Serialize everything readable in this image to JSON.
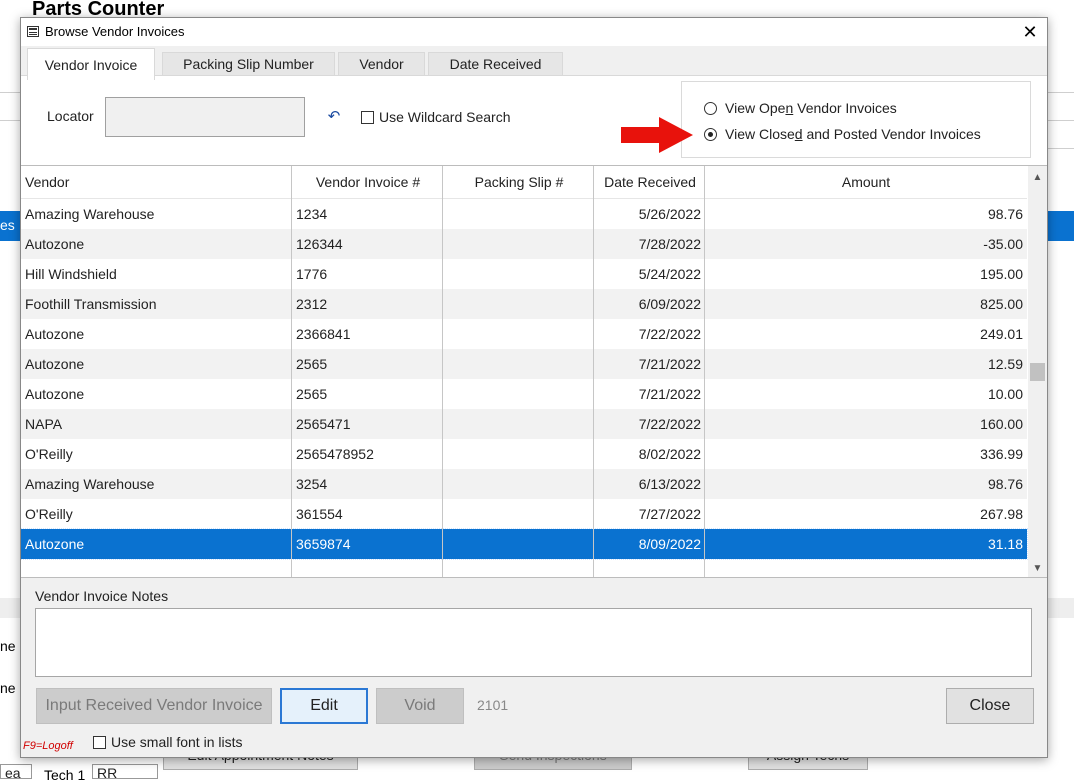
{
  "background": {
    "title": "Parts Counter",
    "blue_row_text": "es",
    "side_labels": [
      "ne",
      "ne"
    ],
    "bottom_buttons": [
      "Edit Appointment Notes",
      "Send Inspections",
      "Assign Techs"
    ],
    "bottom_fields": {
      "left": "ea",
      "tech_label": "Tech 1",
      "tech_value": "RR"
    }
  },
  "dialog": {
    "title": "Browse Vendor Invoices",
    "close_glyph": "✕",
    "tabs": [
      {
        "label": "Vendor Invoice",
        "active": true
      },
      {
        "label": "Packing Slip Number",
        "active": false
      },
      {
        "label": "Vendor",
        "active": false
      },
      {
        "label": "Date Received",
        "active": false
      }
    ],
    "locator": {
      "label": "Locator",
      "value": "",
      "reset_icon": "undo-icon"
    },
    "wildcard": {
      "label": "Use Wildcard Search",
      "checked": false
    },
    "view_options": {
      "open": {
        "prefix": "View Ope",
        "mnemonic": "n",
        "suffix": " Vendor Invoices",
        "selected": false
      },
      "closed": {
        "prefix": "View Close",
        "mnemonic": "d",
        "suffix": " and Posted Vendor Invoices",
        "selected": true
      }
    },
    "annotation_color": "#e8120c",
    "grid": {
      "columns": [
        "Vendor",
        "Vendor Invoice #",
        "Packing Slip #",
        "Date Received",
        "Amount"
      ],
      "rows": [
        {
          "vendor": "Amazing Warehouse",
          "invoice": "1234",
          "slip": "",
          "date": "5/26/2022",
          "amount": "98.76"
        },
        {
          "vendor": "Autozone",
          "invoice": "126344",
          "slip": "",
          "date": "7/28/2022",
          "amount": "-35.00"
        },
        {
          "vendor": "Hill Windshield",
          "invoice": "1776",
          "slip": "",
          "date": "5/24/2022",
          "amount": "195.00"
        },
        {
          "vendor": "Foothill Transmission",
          "invoice": "2312",
          "slip": "",
          "date": "6/09/2022",
          "amount": "825.00"
        },
        {
          "vendor": "Autozone",
          "invoice": "2366841",
          "slip": "",
          "date": "7/22/2022",
          "amount": "249.01"
        },
        {
          "vendor": "Autozone",
          "invoice": "2565",
          "slip": "",
          "date": "7/21/2022",
          "amount": "12.59"
        },
        {
          "vendor": "Autozone",
          "invoice": "2565",
          "slip": "",
          "date": "7/21/2022",
          "amount": "10.00"
        },
        {
          "vendor": "NAPA",
          "invoice": "2565471",
          "slip": "",
          "date": "7/22/2022",
          "amount": "160.00"
        },
        {
          "vendor": "O'Reilly",
          "invoice": "2565478952",
          "slip": "",
          "date": "8/02/2022",
          "amount": "336.99"
        },
        {
          "vendor": "Amazing Warehouse",
          "invoice": "3254",
          "slip": "",
          "date": "6/13/2022",
          "amount": "98.76"
        },
        {
          "vendor": "O'Reilly",
          "invoice": "361554",
          "slip": "",
          "date": "7/27/2022",
          "amount": "267.98"
        },
        {
          "vendor": "Autozone",
          "invoice": "3659874",
          "slip": "",
          "date": "8/09/2022",
          "amount": "31.18",
          "selected": true
        }
      ],
      "selected_color": "#0a72d0"
    },
    "notes": {
      "label": "Vendor Invoice Notes",
      "value": ""
    },
    "buttons": {
      "input_received": "Input Received Vendor Invoice",
      "edit": "Edit",
      "void": "Void",
      "close": "Close"
    },
    "record_count": "2101",
    "logoff_hint": "F9=Logoff",
    "small_font": {
      "label": "Use small font in lists",
      "checked": false
    }
  }
}
